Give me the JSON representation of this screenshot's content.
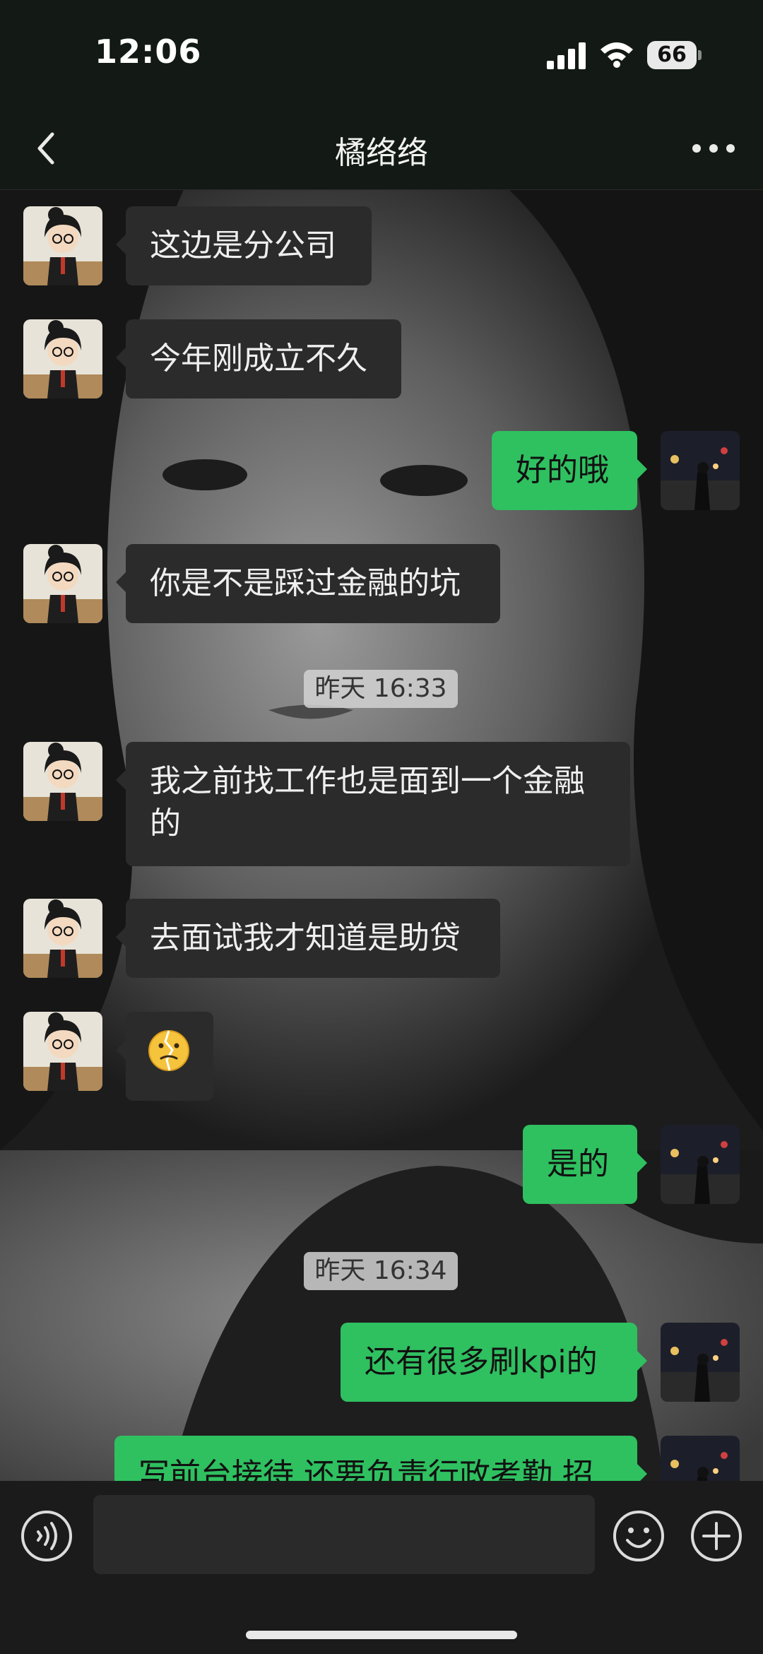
{
  "status_bar": {
    "time": "12:06",
    "battery": "66"
  },
  "header": {
    "title": "橘络络"
  },
  "messages": [
    {
      "side": "in",
      "type": "text",
      "text": "这边是分公司"
    },
    {
      "side": "in",
      "type": "text",
      "text": "今年刚成立不久"
    },
    {
      "side": "out",
      "type": "text",
      "text": "好的哦"
    },
    {
      "side": "in",
      "type": "text",
      "text": "你是不是踩过金融的坑"
    },
    {
      "type": "timestamp",
      "text": "昨天 16:33"
    },
    {
      "side": "in",
      "type": "text",
      "text": "我之前找工作也是面到一个金融的"
    },
    {
      "side": "in",
      "type": "text",
      "text": "去面试我才知道是助贷"
    },
    {
      "side": "in",
      "type": "emoji",
      "text": "",
      "icon": "broken-smile-emoji"
    },
    {
      "side": "out",
      "type": "text",
      "text": "是的"
    },
    {
      "type": "timestamp",
      "text": "昨天 16:34"
    },
    {
      "side": "out",
      "type": "text",
      "text": "还有很多刷kpi的"
    },
    {
      "side": "out",
      "type": "text",
      "text": "写前台接待 还要负责行政考勤 招"
    }
  ],
  "input": {
    "placeholder": ""
  },
  "colors": {
    "outgoing_bubble": "#2fc060",
    "incoming_bubble": "#2b2b2b",
    "bar": "#131a15"
  }
}
